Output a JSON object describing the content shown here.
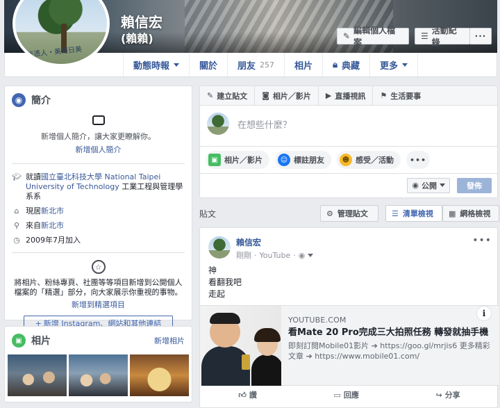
{
  "profile": {
    "name": "賴信宏",
    "alt_name": "(賴賴)",
    "cover_signature": "信憑人‧美術日美"
  },
  "cover_buttons": {
    "edit_profile": "編輯個人檔案",
    "activity_log": "活動紀錄",
    "more": "···"
  },
  "nav": {
    "timeline": "動態時報",
    "about": "關於",
    "friends": "朋友",
    "friends_count": "257",
    "photos": "相片",
    "archive": "典藏",
    "more": "更多"
  },
  "intro": {
    "title": "簡介",
    "prompt": "新增個人簡介，讓大家更瞭解你。",
    "add_bio": "新增個人簡介",
    "study_prefix": "就讀",
    "study_school": "國立臺北科技大學 National Taipei University of Technology",
    "study_suffix": " 工業工程與管理學系系",
    "lives_prefix": "現居",
    "lives_city": "新北市",
    "from_prefix": "來自",
    "from_city": "新北市",
    "joined": "2009年7月加入",
    "featured_text": "將相片、粉絲專頁、社團等等項目新增到公開個人檔案的「精選」部分，向大家展示你重視的事物。",
    "add_featured": "新增到精選項目",
    "add_links": "新增 Instagram、網站和其他連結"
  },
  "photos_card": {
    "title": "相片",
    "add_photos": "新增相片"
  },
  "composer": {
    "tab_create": "建立貼文",
    "tab_photo": "相片／影片",
    "tab_live": "直播視訊",
    "tab_event": "生活要事",
    "placeholder": "在想些什麼？",
    "action_photo": "相片／影片",
    "action_tag": "標註朋友",
    "action_feeling": "感受／活動",
    "action_more": "•••",
    "audience": "公開",
    "post": "發佈"
  },
  "posts_bar": {
    "title": "貼文",
    "manage": "管理貼文",
    "list_view": "清單檢視",
    "grid_view": "網格檢視"
  },
  "post": {
    "author": "賴信宏",
    "time": "剛剛",
    "via": "YouTube",
    "line1": "神",
    "line2": "看翻我吧",
    "line3": "走起",
    "more": "•••",
    "preview_source": "YOUTUBE.COM",
    "preview_title": "看Mate 20 Pro完成三大拍照任務 轉發就抽手機",
    "preview_desc": "即刻訂閱Mobile01影片 ➔ https://goo.gl/mrjis6 更多精彩文章 ➔ https://www.mobile01.com/",
    "info": "i",
    "like": "讚",
    "comment": "回應",
    "share": "分享"
  },
  "colors": {
    "brand_blue": "#4267b2",
    "link_blue": "#365899",
    "background": "#e9ebee"
  }
}
